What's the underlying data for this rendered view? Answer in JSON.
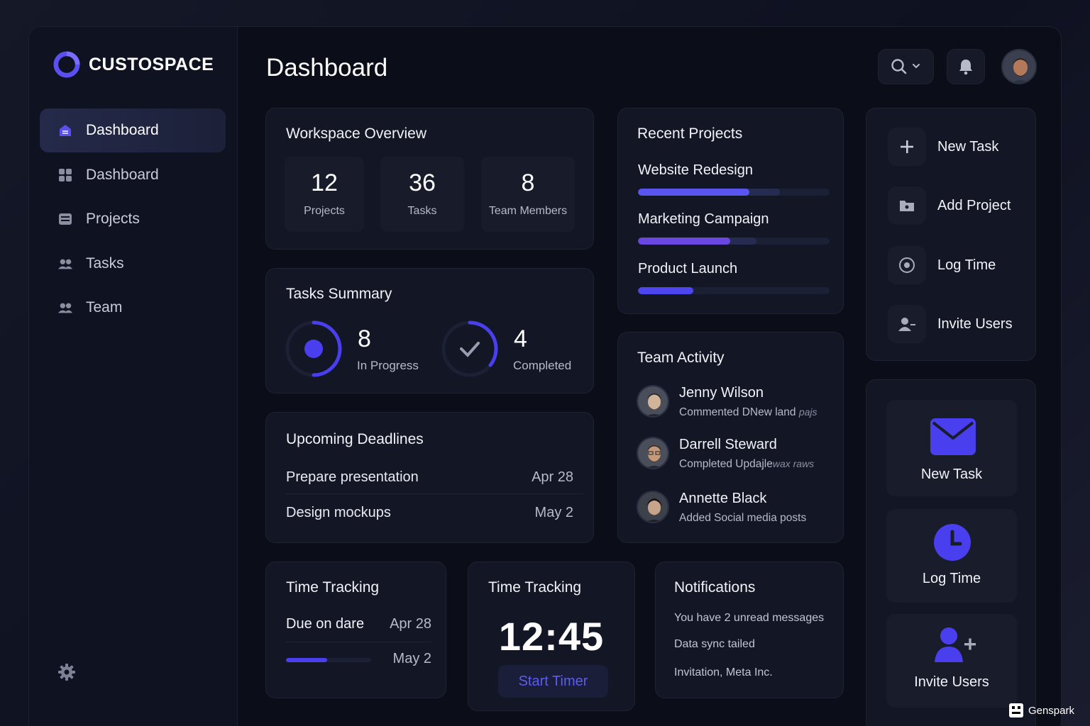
{
  "brand": {
    "name": "CUSTOSPACE",
    "accent": "#4b43e8"
  },
  "sidebar": {
    "items": [
      {
        "label": "Dashboard",
        "icon": "home-icon",
        "active": true
      },
      {
        "label": "Dashboard",
        "icon": "grid-icon",
        "active": false
      },
      {
        "label": "Projects",
        "icon": "list-icon",
        "active": false
      },
      {
        "label": "Tasks",
        "icon": "users-icon",
        "active": false
      },
      {
        "label": "Team",
        "icon": "users-icon",
        "active": false
      }
    ],
    "settings_icon": "gear-icon"
  },
  "header": {
    "title": "Dashboard"
  },
  "overview": {
    "title": "Workspace Overview",
    "stats": [
      {
        "value": "12",
        "label": "Projects"
      },
      {
        "value": "36",
        "label": "Tasks"
      },
      {
        "value": "8",
        "label": "Team Members"
      }
    ]
  },
  "tasks_summary": {
    "title": "Tasks Summary",
    "in_progress": {
      "value": "8",
      "label": "In Progress"
    },
    "completed": {
      "value": "4",
      "label": "Completed"
    }
  },
  "deadlines": {
    "title": "Upcoming Deadlines",
    "rows": [
      {
        "name": "Prepare presentation",
        "date": "Apr 28"
      },
      {
        "name": "Design mockups",
        "date": "May 2"
      }
    ]
  },
  "time_tracking_1": {
    "title": "Time Tracking",
    "row1_label": "Due on dare",
    "row1_date": "Apr 28",
    "row2_date": "May 2",
    "progress": 0.48
  },
  "time_tracking_2": {
    "title": "Time Tracking",
    "time": "12:45",
    "button": "Start Timer"
  },
  "notifications": {
    "title": "Notifications",
    "lines": [
      "You have 2 unread messages",
      "Data sync tailed",
      "Invitation, Meta Inc."
    ]
  },
  "recent_projects": {
    "title": "Recent Projects",
    "items": [
      {
        "name": "Website Redesign",
        "progress": 0.58,
        "secondary": 0.74,
        "color": "#5a55f0"
      },
      {
        "name": "Marketing Campaign",
        "progress": 0.48,
        "secondary": 0.62,
        "color": "#6a48e0"
      },
      {
        "name": "Product Launch",
        "progress": 0.29,
        "secondary": 0.29,
        "color": "#4d45ee"
      }
    ]
  },
  "team_activity": {
    "title": "Team Activity",
    "items": [
      {
        "name": "Jenny Wilson",
        "desc": "Commented DNew land",
        "desc_tail": "pajs"
      },
      {
        "name": "Darrell Steward",
        "desc": "Completed Updajle",
        "desc_tail": "wax raws"
      },
      {
        "name": "Annette Black",
        "desc": "Added Social media posts",
        "desc_tail": ""
      }
    ]
  },
  "quick_actions": {
    "items": [
      {
        "label": "New Task",
        "icon": "plus-icon"
      },
      {
        "label": "Add Project",
        "icon": "folder-icon"
      },
      {
        "label": "Log Time",
        "icon": "target-icon"
      },
      {
        "label": "Invite Users",
        "icon": "user-add-icon"
      }
    ]
  },
  "tiles": {
    "items": [
      {
        "label": "New Task",
        "icon": "mail-icon"
      },
      {
        "label": "Log Time",
        "icon": "clock-icon"
      },
      {
        "label": "Invite Users",
        "icon": "user-add-icon"
      }
    ]
  },
  "watermark": {
    "text": "Genspark"
  }
}
